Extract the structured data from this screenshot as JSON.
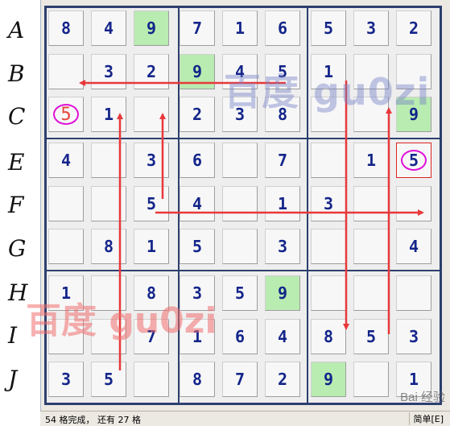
{
  "row_labels": [
    "A",
    "B",
    "C",
    "E",
    "F",
    "G",
    "H",
    "I",
    "J"
  ],
  "grid": [
    [
      {
        "v": "8"
      },
      {
        "v": "4"
      },
      {
        "v": "9",
        "given": true
      },
      {
        "v": "7"
      },
      {
        "v": "1"
      },
      {
        "v": "6"
      },
      {
        "v": "5"
      },
      {
        "v": "3"
      },
      {
        "v": "2"
      }
    ],
    [
      {
        "v": ""
      },
      {
        "v": "3"
      },
      {
        "v": "2"
      },
      {
        "v": "9",
        "given": true
      },
      {
        "v": "4"
      },
      {
        "v": "5"
      },
      {
        "v": "1"
      },
      {
        "v": ""
      },
      {
        "v": ""
      }
    ],
    [
      {
        "v": "5",
        "mark": "circled-red"
      },
      {
        "v": "1"
      },
      {
        "v": ""
      },
      {
        "v": "2"
      },
      {
        "v": "3"
      },
      {
        "v": "8"
      },
      {
        "v": ""
      },
      {
        "v": ""
      },
      {
        "v": "9",
        "given": true
      }
    ],
    [
      {
        "v": "4"
      },
      {
        "v": ""
      },
      {
        "v": "3"
      },
      {
        "v": "6"
      },
      {
        "v": ""
      },
      {
        "v": "7"
      },
      {
        "v": ""
      },
      {
        "v": "1"
      },
      {
        "v": "5",
        "mark": "circled",
        "selected": true
      }
    ],
    [
      {
        "v": ""
      },
      {
        "v": ""
      },
      {
        "v": "5"
      },
      {
        "v": "4"
      },
      {
        "v": ""
      },
      {
        "v": "1"
      },
      {
        "v": "3"
      },
      {
        "v": ""
      },
      {
        "v": ""
      }
    ],
    [
      {
        "v": ""
      },
      {
        "v": "8"
      },
      {
        "v": "1"
      },
      {
        "v": "5"
      },
      {
        "v": ""
      },
      {
        "v": "3"
      },
      {
        "v": ""
      },
      {
        "v": ""
      },
      {
        "v": "4"
      }
    ],
    [
      {
        "v": "1"
      },
      {
        "v": ""
      },
      {
        "v": "8"
      },
      {
        "v": "3"
      },
      {
        "v": "5"
      },
      {
        "v": "9",
        "given": true
      },
      {
        "v": ""
      },
      {
        "v": ""
      },
      {
        "v": ""
      }
    ],
    [
      {
        "v": ""
      },
      {
        "v": ""
      },
      {
        "v": "7"
      },
      {
        "v": "1"
      },
      {
        "v": "6"
      },
      {
        "v": "4"
      },
      {
        "v": "8"
      },
      {
        "v": "5"
      },
      {
        "v": "3"
      }
    ],
    [
      {
        "v": "3"
      },
      {
        "v": "5"
      },
      {
        "v": ""
      },
      {
        "v": "8"
      },
      {
        "v": "7"
      },
      {
        "v": "2"
      },
      {
        "v": "9",
        "given": true
      },
      {
        "v": ""
      },
      {
        "v": "1"
      }
    ]
  ],
  "watermark_top": "百度 gu0zi",
  "watermark_bottom": "百度 gu0zi",
  "baidu_mark": "Bai 经验",
  "status": {
    "text": "54 格完成， 还有 27 格",
    "mode": "简单[E]"
  },
  "colors": {
    "board_border": "#2c3f6e",
    "digit": "#14258a",
    "given_bg": "#b8ecb0",
    "arrow": "#e8383a",
    "circle": "#e010d8"
  }
}
